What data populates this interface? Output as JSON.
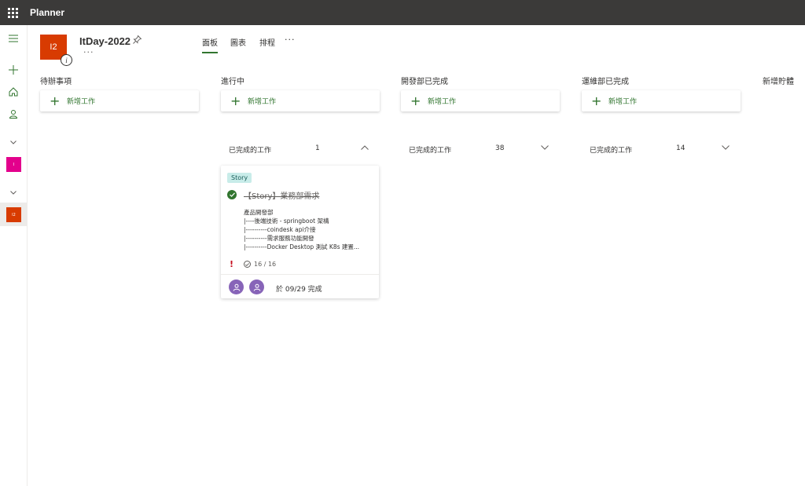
{
  "app": {
    "name": "Planner"
  },
  "plan": {
    "logo_text": "I2",
    "title": "ItDay-2022",
    "more": "···"
  },
  "tabs": [
    {
      "label": "面板",
      "active": true
    },
    {
      "label": "圖表",
      "active": false
    },
    {
      "label": "排程",
      "active": false
    }
  ],
  "tabs_more": "···",
  "rail": {
    "plan1_text": "I",
    "plan2_text": "I2"
  },
  "add_task_label": "新增工作",
  "buckets": [
    {
      "title": "待辦事項"
    },
    {
      "title": "進行中",
      "completed_label": "已完成的工作",
      "completed_count": "1"
    },
    {
      "title": "開發部已完成",
      "completed_label": "已完成的工作",
      "completed_count": "38"
    },
    {
      "title": "運維部已完成",
      "completed_label": "已完成的工作",
      "completed_count": "14"
    },
    {
      "title": "新增貯體"
    }
  ],
  "card": {
    "label": "Story",
    "title": "【Story】業務部需求",
    "description": "產品開發部\n|----後端技術 - springboot 架構\n|----------coindesk api介接\n|----------需求服務功能開發\n|----------Docker Desktop 測試 K8s 建置...",
    "priority_icon": "!",
    "checklist": "16 / 16",
    "due": "於 09/29 完成"
  },
  "colors": {
    "accent": "#31752f",
    "plan_logo": "#d83b01",
    "rail_plan1": "#e3008c",
    "avatar": "#8764b8",
    "topbar": "#3b3a39"
  }
}
